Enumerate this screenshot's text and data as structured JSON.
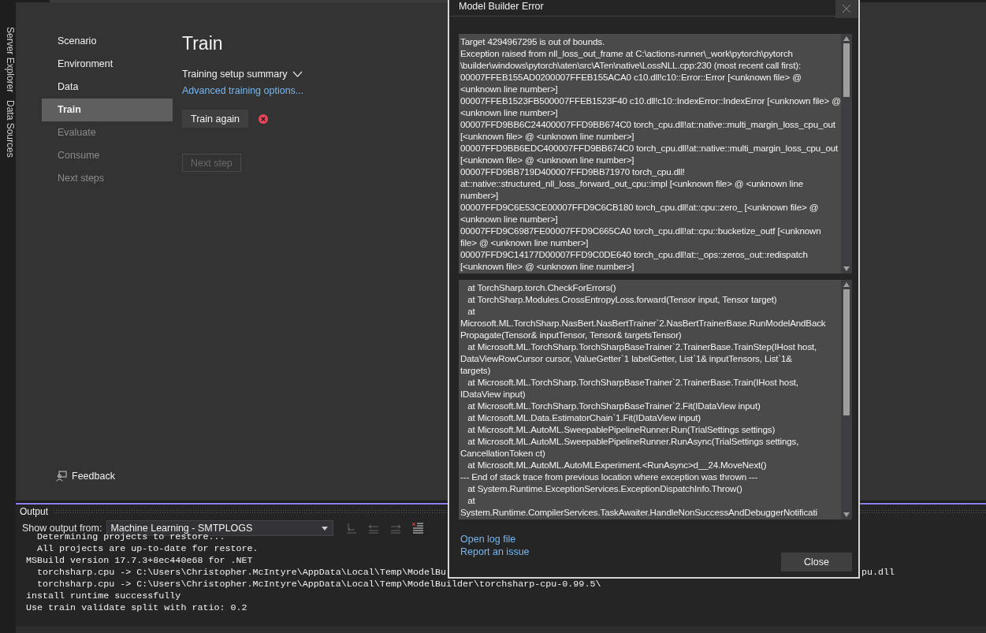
{
  "side_tabs": [
    "Server Explorer",
    "Data Sources"
  ],
  "nav": [
    {
      "label": "Scenario",
      "selected": false,
      "disabled": false
    },
    {
      "label": "Environment",
      "selected": false,
      "disabled": false
    },
    {
      "label": "Data",
      "selected": false,
      "disabled": false
    },
    {
      "label": "Train",
      "selected": true,
      "disabled": false
    },
    {
      "label": "Evaluate",
      "selected": false,
      "disabled": true
    },
    {
      "label": "Consume",
      "selected": false,
      "disabled": true
    },
    {
      "label": "Next steps",
      "selected": false,
      "disabled": true
    }
  ],
  "page": {
    "title": "Train",
    "summary_toggle": "Training setup summary",
    "advanced_link": "Advanced training options...",
    "train_button": "Train again",
    "error": true,
    "next_button": {
      "label": "Next step",
      "disabled": true
    }
  },
  "feedback": "Feedback",
  "output": {
    "title": "Output",
    "source_label": "Show output from:",
    "source": "Machine Learning - SMTPLOGS",
    "lines": [
      {
        "text": "  Determining projects to restore..."
      },
      {
        "text": "  All projects are up-to-date for restore."
      },
      {
        "text": "MSBuild version 17.7.3+8ec440e68 for .NET"
      },
      {
        "text": "  torchsharp.cpu -> C:\\Users\\Christopher.McIntyre\\AppData\\Local\\Temp\\ModelBu",
        "tail": "pu.dll"
      },
      {
        "text": "  torchsharp.cpu -> C:\\Users\\Christopher.McIntyre\\AppData\\Local\\Temp\\ModelBuilder\\torchsharp-cpu-0.99.5\\"
      },
      {
        "text": "install runtime successfully"
      },
      {
        "text": "Use train validate split with ratio: 0.2"
      }
    ]
  },
  "dialog": {
    "title": "Model Builder Error",
    "message_lines": [
      "Target 4294967295 is out of bounds.",
      "Exception raised from nll_loss_out_frame at C:\\actions-runner\\_work\\pytorch\\pytorch",
      "\\builder\\windows\\pytorch\\aten\\src\\ATen\\native\\LossNLL.cpp:230 (most recent call first):",
      "00007FFEB155AD0200007FFEB155ACA0 c10.dll!c10::Error::Error [<unknown file> @",
      "<unknown line number>]",
      "00007FFEB1523FB500007FFEB1523F40 c10.dll!c10::IndexError::IndexError [<unknown file> @",
      "<unknown line number>]",
      "00007FFD9BB6C24400007FFD9BB674C0 torch_cpu.dll!at::native::multi_margin_loss_cpu_out",
      "[<unknown file> @ <unknown line number>]",
      "00007FFD9BB6EDC400007FFD9BB674C0 torch_cpu.dll!at::native::multi_margin_loss_cpu_out",
      "[<unknown file> @ <unknown line number>]",
      "00007FFD9BB719D400007FFD9BB71970 torch_cpu.dll!",
      "at::native::structured_nll_loss_forward_out_cpu::impl [<unknown file> @ <unknown line",
      "number>]",
      "00007FFD9C6E53CE00007FFD9C6CB180 torch_cpu.dll!at::cpu::zero_ [<unknown file> @",
      "<unknown line number>]",
      "00007FFD9C6987FE00007FFD9C665CA0 torch_cpu.dll!at::cpu::bucketize_outf [<unknown",
      "file> @ <unknown line number>]",
      "00007FFD9C14177D00007FFD9C0DE640 torch_cpu.dll!at::_ops::zeros_out::redispatch",
      "[<unknown file> @ <unknown line number>]"
    ],
    "stack_lines": [
      "   at TorchSharp.torch.CheckForErrors()",
      "   at TorchSharp.Modules.CrossEntropyLoss.forward(Tensor input, Tensor target)",
      "   at",
      "Microsoft.ML.TorchSharp.NasBert.NasBertTrainer`2.NasBertTrainerBase.RunModelAndBack",
      "Propagate(Tensor& inputTensor, Tensor& targetsTensor)",
      "   at Microsoft.ML.TorchSharp.TorchSharpBaseTrainer`2.TrainerBase.TrainStep(IHost host,",
      "DataViewRowCursor cursor, ValueGetter`1 labelGetter, List`1& inputTensors, List`1&",
      "targets)",
      "   at Microsoft.ML.TorchSharp.TorchSharpBaseTrainer`2.TrainerBase.Train(IHost host,",
      "IDataView input)",
      "   at Microsoft.ML.TorchSharp.TorchSharpBaseTrainer`2.Fit(IDataView input)",
      "   at Microsoft.ML.Data.EstimatorChain`1.Fit(IDataView input)",
      "   at Microsoft.ML.AutoML.SweepablePipelineRunner.Run(TrialSettings settings)",
      "   at Microsoft.ML.AutoML.SweepablePipelineRunner.RunAsync(TrialSettings settings,",
      "CancellationToken ct)",
      "   at Microsoft.ML.AutoML.AutoMLExperiment.<RunAsync>d__24.MoveNext()",
      "--- End of stack trace from previous location where exception was thrown ---",
      "   at System.Runtime.ExceptionServices.ExceptionDispatchInfo.Throw()",
      "   at",
      "System.Runtime.CompilerServices.TaskAwaiter.HandleNonSuccessAndDebuggerNotificati"
    ],
    "links": [
      "Open log file",
      "Report an issue"
    ],
    "close_button": "Close"
  }
}
